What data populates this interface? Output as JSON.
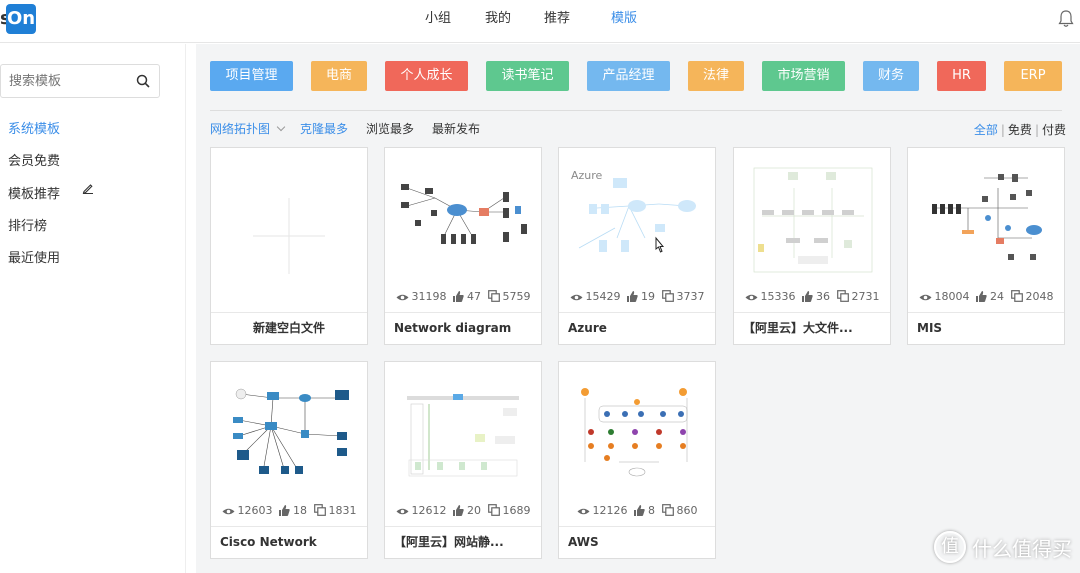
{
  "app": {
    "logo_text": "On",
    "logo_prefix": "s"
  },
  "nav": {
    "items": [
      {
        "label": "小组",
        "active": false
      },
      {
        "label": "我的",
        "active": false
      },
      {
        "label": "推荐",
        "active": false
      },
      {
        "label": "模版",
        "active": true
      }
    ]
  },
  "sidebar": {
    "search_placeholder": "搜索模板",
    "items": [
      {
        "label": "系统模板",
        "active": true
      },
      {
        "label": "会员免费",
        "active": false
      },
      {
        "label": "模板推荐",
        "active": false
      },
      {
        "label": "排行榜",
        "active": false
      },
      {
        "label": "最近使用",
        "active": false
      }
    ]
  },
  "tags": [
    {
      "label": "项目管理",
      "color": "#5aa9f0"
    },
    {
      "label": "电商",
      "color": "#f5b55a"
    },
    {
      "label": "个人成长",
      "color": "#f0685a"
    },
    {
      "label": "读书笔记",
      "color": "#5ec88f"
    },
    {
      "label": "产品经理",
      "color": "#74b8ef"
    },
    {
      "label": "法律",
      "color": "#f5b55a"
    },
    {
      "label": "市场营销",
      "color": "#5ec88f"
    },
    {
      "label": "财务",
      "color": "#74b8ef"
    },
    {
      "label": "HR",
      "color": "#f0685a"
    },
    {
      "label": "ERP",
      "color": "#f5b55a"
    }
  ],
  "filters": {
    "category": "网络拓扑图",
    "sort": [
      {
        "label": "克隆最多",
        "active": true
      },
      {
        "label": "浏览最多",
        "active": false
      },
      {
        "label": "最新发布",
        "active": false
      }
    ],
    "price": [
      {
        "label": "全部",
        "active": true
      },
      {
        "label": "免费",
        "active": false
      },
      {
        "label": "付费",
        "active": false
      }
    ],
    "price_sep": "|"
  },
  "cards": [
    {
      "title": "新建空白文件",
      "blank": true
    },
    {
      "title": "Network diagram",
      "views": "31198",
      "likes": "47",
      "clones": "5759"
    },
    {
      "title": "Azure",
      "views": "15429",
      "likes": "19",
      "clones": "3737",
      "thumb_label": "Azure"
    },
    {
      "title": "【阿里云】大文件...",
      "views": "15336",
      "likes": "36",
      "clones": "2731"
    },
    {
      "title": "MIS",
      "views": "18004",
      "likes": "24",
      "clones": "2048"
    },
    {
      "title": "Cisco Network",
      "views": "12603",
      "likes": "18",
      "clones": "1831"
    },
    {
      "title": "【阿里云】网站静...",
      "views": "12612",
      "likes": "20",
      "clones": "1689"
    },
    {
      "title": "AWS",
      "views": "12126",
      "likes": "8",
      "clones": "860"
    }
  ],
  "watermark": {
    "icon": "值",
    "text": "什么值得买"
  },
  "accent_color": "#3b8ee8"
}
